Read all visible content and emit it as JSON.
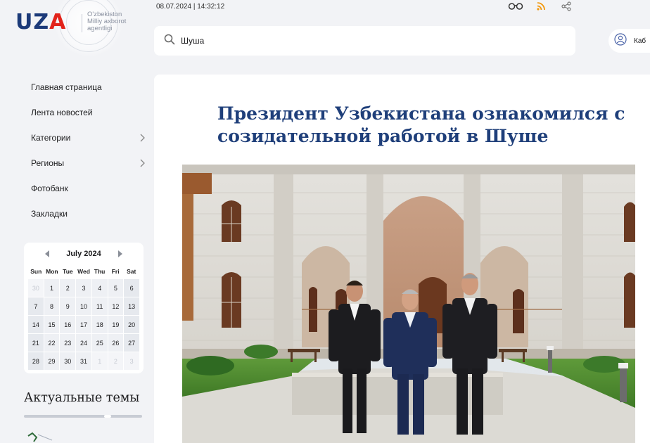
{
  "logo": {
    "mark_main": "UZ",
    "mark_accent": "A",
    "sub_lines": [
      "O'zbekiston",
      "Milliy axborot",
      "agentligi"
    ]
  },
  "header": {
    "datetime": "08.07.2024 | 14:32:12",
    "icons": [
      "glasses-icon",
      "rss-icon",
      "share-icon"
    ]
  },
  "search": {
    "value": "Шуша",
    "placeholder": ""
  },
  "cabinet": {
    "label": "Каб"
  },
  "nav": {
    "items": [
      {
        "label": "Главная страница",
        "has_arrow": false
      },
      {
        "label": "Лента новостей",
        "has_arrow": false
      },
      {
        "label": "Категории",
        "has_arrow": true
      },
      {
        "label": "Регионы",
        "has_arrow": true
      },
      {
        "label": "Фотобанк",
        "has_arrow": false
      },
      {
        "label": "Закладки",
        "has_arrow": false
      }
    ]
  },
  "calendar": {
    "title": "July 2024",
    "weekdays": [
      "Sun",
      "Mon",
      "Tue",
      "Wed",
      "Thu",
      "Fri",
      "Sat"
    ],
    "days": [
      {
        "d": "30",
        "muted": true
      },
      {
        "d": "1"
      },
      {
        "d": "2"
      },
      {
        "d": "3"
      },
      {
        "d": "4"
      },
      {
        "d": "5"
      },
      {
        "d": "6"
      },
      {
        "d": "7"
      },
      {
        "d": "8"
      },
      {
        "d": "9"
      },
      {
        "d": "10"
      },
      {
        "d": "11"
      },
      {
        "d": "12"
      },
      {
        "d": "13"
      },
      {
        "d": "14"
      },
      {
        "d": "15"
      },
      {
        "d": "16"
      },
      {
        "d": "17"
      },
      {
        "d": "18"
      },
      {
        "d": "19"
      },
      {
        "d": "20"
      },
      {
        "d": "21"
      },
      {
        "d": "22"
      },
      {
        "d": "23"
      },
      {
        "d": "24"
      },
      {
        "d": "25"
      },
      {
        "d": "26"
      },
      {
        "d": "27"
      },
      {
        "d": "28"
      },
      {
        "d": "29"
      },
      {
        "d": "30"
      },
      {
        "d": "31"
      },
      {
        "d": "1",
        "muted": true
      },
      {
        "d": "2",
        "muted": true
      },
      {
        "d": "3",
        "muted": true
      }
    ]
  },
  "topics": {
    "title": "Актуальные темы"
  },
  "article": {
    "title": "Президент Узбекистана ознакомился с созидательной работой в Шуше"
  },
  "colors": {
    "brand_blue": "#1c3a79",
    "brand_red": "#e2231a",
    "title_blue": "#1f3f7a",
    "rss_orange": "#f29a12",
    "page_bg": "#f2f3f6"
  }
}
